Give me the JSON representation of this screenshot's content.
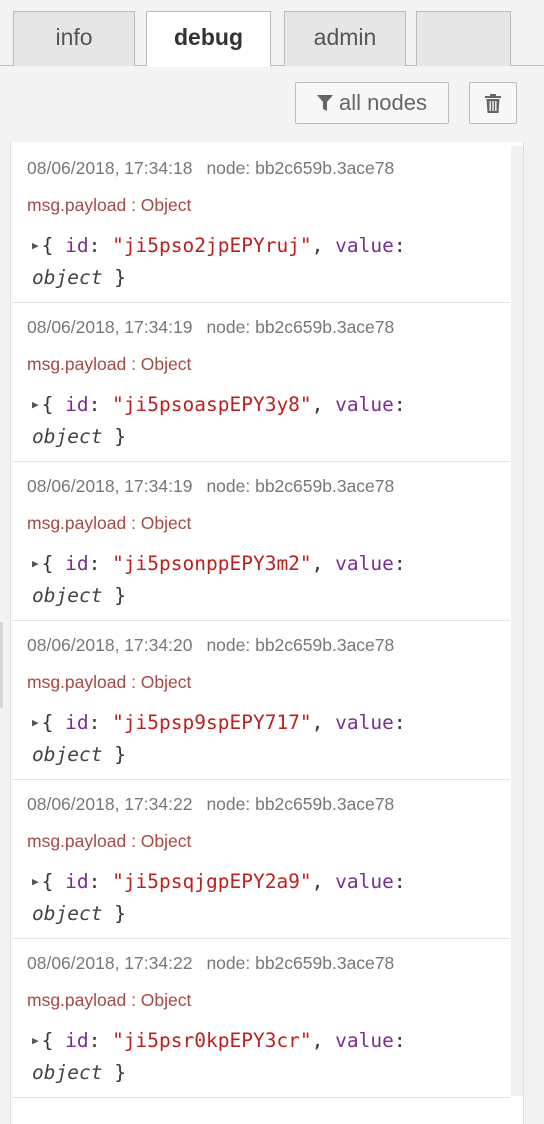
{
  "tabs": [
    {
      "label": "info"
    },
    {
      "label": "debug"
    },
    {
      "label": "admin"
    },
    {
      "label": ""
    }
  ],
  "toolbar": {
    "filter_label": "all nodes",
    "filter_icon": "funnel-icon",
    "clear_icon": "trash-icon"
  },
  "messages": [
    {
      "timestamp": "08/06/2018, 17:34:18",
      "node": "node: bb2c659b.3ace78",
      "topic": "msg.payload : Object",
      "id_key": "id",
      "id_value": "\"ji5pso2jpEPYruj\"",
      "value_key": "value",
      "value_type": "object"
    },
    {
      "timestamp": "08/06/2018, 17:34:19",
      "node": "node: bb2c659b.3ace78",
      "topic": "msg.payload : Object",
      "id_key": "id",
      "id_value": "\"ji5psoaspEPY3y8\"",
      "value_key": "value",
      "value_type": "object"
    },
    {
      "timestamp": "08/06/2018, 17:34:19",
      "node": "node: bb2c659b.3ace78",
      "topic": "msg.payload : Object",
      "id_key": "id",
      "id_value": "\"ji5psonppEPY3m2\"",
      "value_key": "value",
      "value_type": "object"
    },
    {
      "timestamp": "08/06/2018, 17:34:20",
      "node": "node: bb2c659b.3ace78",
      "topic": "msg.payload : Object",
      "id_key": "id",
      "id_value": "\"ji5psp9spEPY717\"",
      "value_key": "value",
      "value_type": "object"
    },
    {
      "timestamp": "08/06/2018, 17:34:22",
      "node": "node: bb2c659b.3ace78",
      "topic": "msg.payload : Object",
      "id_key": "id",
      "id_value": "\"ji5psqjgpEPY2a9\"",
      "value_key": "value",
      "value_type": "object"
    },
    {
      "timestamp": "08/06/2018, 17:34:22",
      "node": "node: bb2c659b.3ace78",
      "topic": "msg.payload : Object",
      "id_key": "id",
      "id_value": "\"ji5psr0kpEPY3cr\"",
      "value_key": "value",
      "value_type": "object"
    }
  ]
}
